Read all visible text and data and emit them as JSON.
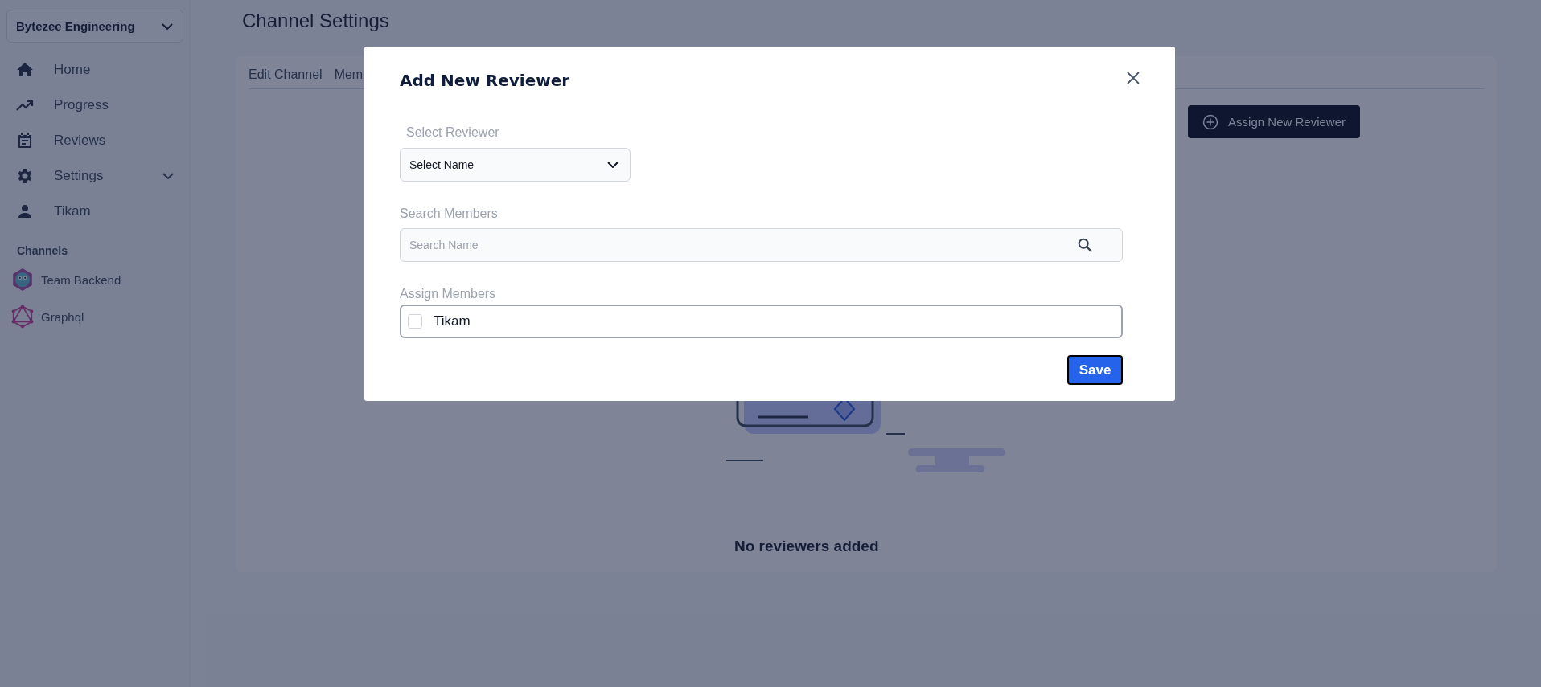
{
  "workspace": {
    "name": "Bytezee Engineering"
  },
  "nav": [
    {
      "label": "Home",
      "expandable": false
    },
    {
      "label": "Progress",
      "expandable": false
    },
    {
      "label": "Reviews",
      "expandable": false
    },
    {
      "label": "Settings",
      "expandable": true
    },
    {
      "label": "Tikam",
      "expandable": false
    }
  ],
  "channels": {
    "heading": "Channels",
    "items": [
      {
        "label": "Team Backend"
      },
      {
        "label": "Graphql"
      }
    ]
  },
  "page_title": "Channel Settings",
  "tabs": [
    {
      "label": "Edit Channel"
    },
    {
      "label": "Mem"
    }
  ],
  "assign_button": {
    "label": "Assign New Reviewer"
  },
  "empty_state": {
    "text": "No reviewers added"
  },
  "modal": {
    "title": "Add New Reviewer",
    "select_reviewer": {
      "label": "Select Reviewer",
      "value": "Select Name"
    },
    "search_members": {
      "label": "Search Members",
      "placeholder": "Search Name"
    },
    "assign_members": {
      "label": "Assign Members",
      "members": [
        {
          "name": "Tikam",
          "checked": false
        }
      ]
    },
    "save_button": {
      "label": "Save"
    }
  }
}
